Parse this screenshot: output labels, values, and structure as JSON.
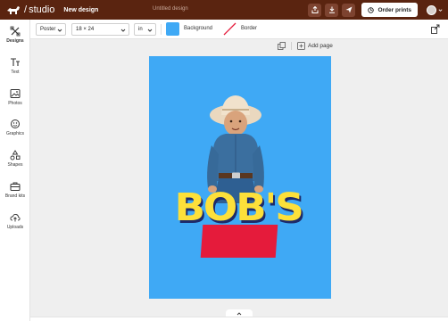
{
  "header": {
    "brand": "studio",
    "design_menu": "New design",
    "document_title": "Untitled design",
    "order_label": "Order prints",
    "avatar_initial": "a"
  },
  "sidebar": {
    "items": [
      {
        "label": "Designs",
        "icon": "designs-icon"
      },
      {
        "label": "Text",
        "icon": "text-icon"
      },
      {
        "label": "Photos",
        "icon": "photo-icon"
      },
      {
        "label": "Graphics",
        "icon": "graphics-icon"
      },
      {
        "label": "Shapes",
        "icon": "shapes-icon"
      },
      {
        "label": "Brand kits",
        "icon": "briefcase-icon"
      },
      {
        "label": "Uploads",
        "icon": "upload-icon"
      }
    ]
  },
  "options": {
    "format": "Poster",
    "size": "18 × 24",
    "unit": "in",
    "background_label": "Background",
    "border_label": "Border",
    "background_color": "#3fa9f5"
  },
  "canvas": {
    "add_page_label": "Add page",
    "poster_text": "BOB'S",
    "background_color": "#3fa9f5",
    "text_color": "#fde03a",
    "accent_color": "#e51b3b"
  },
  "colors": {
    "topbar": "#5a2410",
    "accent": "#3fa9f5"
  }
}
